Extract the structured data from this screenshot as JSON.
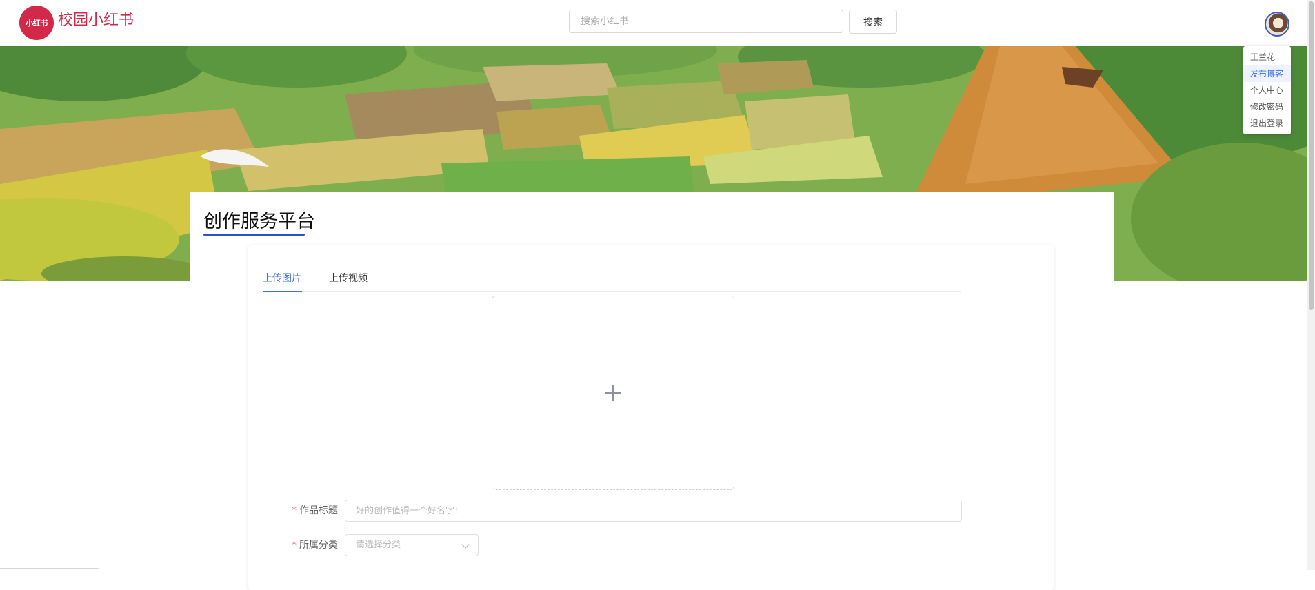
{
  "header": {
    "logo_badge": "小红书",
    "site_name": "校园小红书",
    "search_placeholder": "搜索小红书",
    "search_button": "搜索"
  },
  "user_menu": {
    "items": [
      {
        "label": "王兰花",
        "active": false
      },
      {
        "label": "发布博客",
        "active": true
      },
      {
        "label": "个人中心",
        "active": false
      },
      {
        "label": "修改密码",
        "active": false
      },
      {
        "label": "退出登录",
        "active": false
      }
    ]
  },
  "main": {
    "page_title": "创作服务平台",
    "tabs": [
      {
        "label": "上传图片",
        "active": true
      },
      {
        "label": "上传视频",
        "active": false
      }
    ],
    "form": {
      "title_label": "作品标题",
      "title_placeholder": "好的创作值得一个好名字!",
      "category_label": "所属分类",
      "category_placeholder": "请选择分类",
      "required_mark": "*"
    }
  },
  "colors": {
    "brand": "#d2294a",
    "accent": "#3a72e8",
    "title_underline": "#2b4fd6"
  }
}
